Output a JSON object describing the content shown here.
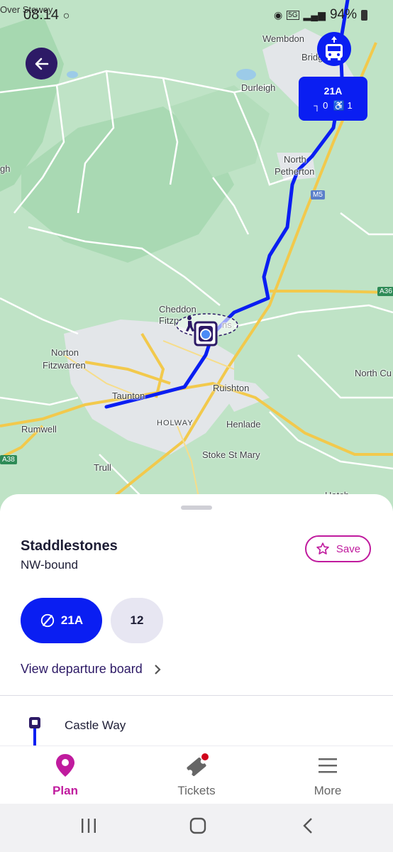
{
  "status_bar": {
    "carrier_text": "Over Stowey",
    "time": "08:14",
    "battery": "94%",
    "network": "5G"
  },
  "map": {
    "places": [
      {
        "name": "Wembdon"
      },
      {
        "name": "Bridg"
      },
      {
        "name": "Durleigh"
      },
      {
        "name": "North"
      },
      {
        "name": "Petherton"
      },
      {
        "name": "gh"
      },
      {
        "name": "Cheddon"
      },
      {
        "name": "Fitzp"
      },
      {
        "name": "ns"
      },
      {
        "name": "Norton"
      },
      {
        "name": "Fitzwarren"
      },
      {
        "name": "Taunton"
      },
      {
        "name": "Ruishton"
      },
      {
        "name": "HOLWAY"
      },
      {
        "name": "Henlade"
      },
      {
        "name": "Rumwell"
      },
      {
        "name": "Stoke St Mary"
      },
      {
        "name": "Trull"
      },
      {
        "name": "North Cu"
      },
      {
        "name": "Hatch"
      }
    ],
    "road_labels": {
      "m5": "M5",
      "a36": "A36",
      "a38": "A38"
    },
    "route_color": "#0a1ef2"
  },
  "bus_card": {
    "route": "21A",
    "seats": "0",
    "wheelchair": "1"
  },
  "stop": {
    "name": "Staddlestones",
    "direction": "NW-bound",
    "save_label": "Save",
    "routes": [
      {
        "label": "21A",
        "active": true
      },
      {
        "label": "12",
        "active": false
      }
    ],
    "departure_board_label": "View departure board",
    "next_stop": "Castle Way"
  },
  "nav": {
    "plan": "Plan",
    "tickets": "Tickets",
    "more": "More"
  },
  "colors": {
    "accent": "#c01b9e",
    "route_blue": "#0a1ef2",
    "dark_purple": "#2d1a66"
  }
}
